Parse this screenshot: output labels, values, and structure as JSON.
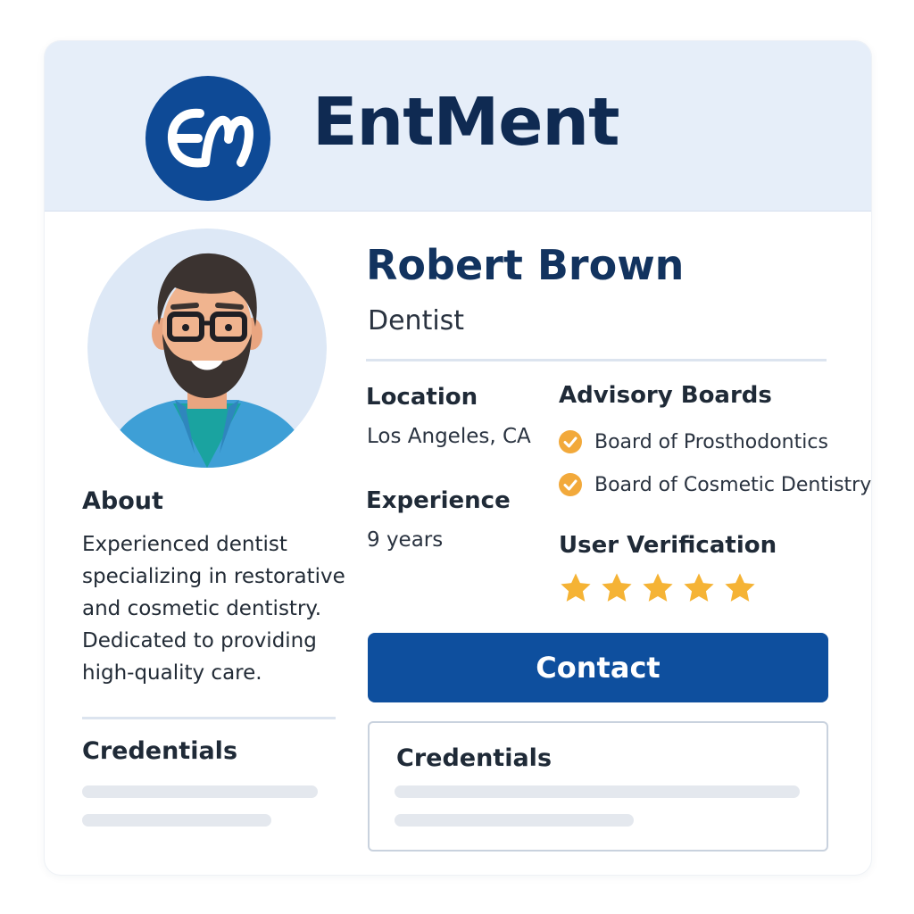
{
  "brand": {
    "name": "EntMent",
    "logo_monogram": "EM",
    "color": "#0f2a52",
    "logo_color": "#0e4a96"
  },
  "profile": {
    "name": "Robert Brown",
    "title": "Dentist",
    "avatar_icon": "person-avatar-icon"
  },
  "about": {
    "heading": "About",
    "text": "Experienced dentist\nspecializing in restorative\nand cosmetic dentistry.\nDedicated to providing\nhigh-quality care."
  },
  "details": {
    "location_label": "Location",
    "location_value": "Los Angeles, CA",
    "experience_label": "Experience",
    "experience_value": "9 years"
  },
  "advisory": {
    "heading": "Advisory Boards",
    "boards": [
      "Board of Prosthodontics",
      "Board of Cosmetic Dentistry"
    ],
    "check_icon": "check-circle-icon",
    "check_color": "#f2a93b"
  },
  "verification": {
    "heading": "User Verification",
    "rating": 5,
    "max_rating": 5,
    "star_icon": "star-icon",
    "star_color": "#f5b335"
  },
  "contact": {
    "label": "Contact",
    "color": "#0e4f9e"
  },
  "credentials": {
    "left_heading": "Credentials",
    "box_heading": "Credentials"
  }
}
